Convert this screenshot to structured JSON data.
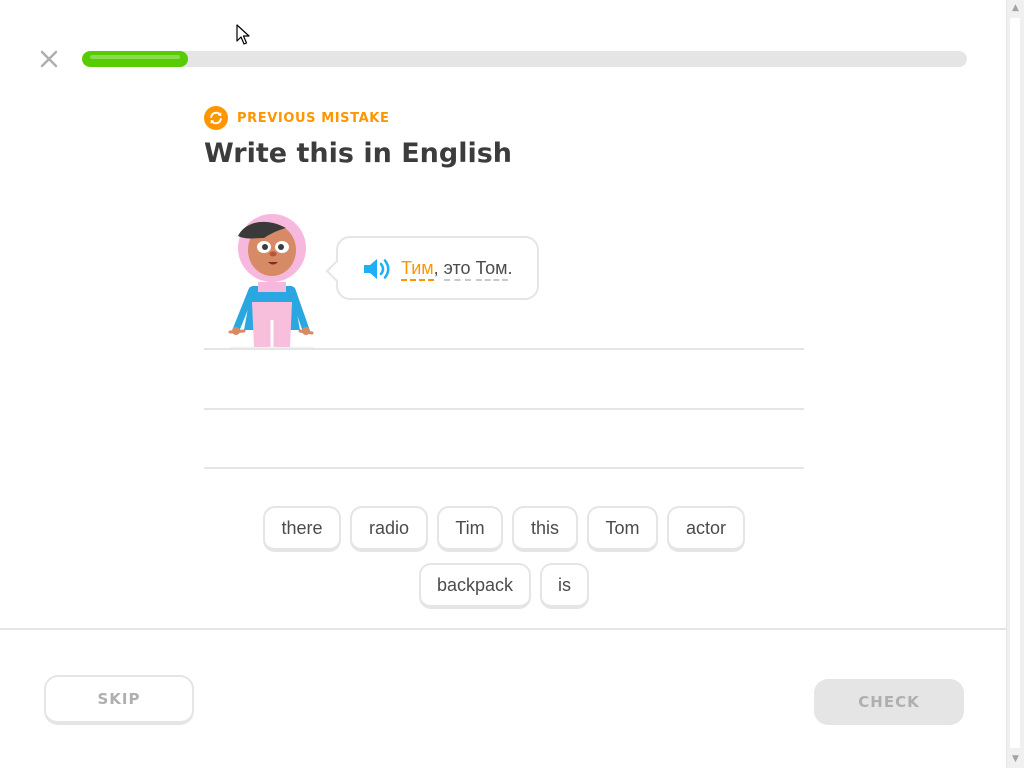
{
  "header": {
    "close_icon": "close-icon",
    "progress": 0.12,
    "progress_color": "#58cc02"
  },
  "challenge": {
    "tag_icon": "refresh-icon",
    "tag": "PREVIOUS MISTAKE",
    "tag_color": "#ff9600",
    "title": "Write this in English"
  },
  "prompt": {
    "speaker_icon": "speaker-icon",
    "highlighted_word": "Тим",
    "comma": ",",
    "word2": "это",
    "word3": "Том",
    "period": "."
  },
  "word_bank": {
    "row1": [
      "there",
      "radio",
      "Tim",
      "this",
      "Tom",
      "actor"
    ],
    "row2": [
      "backpack",
      "is"
    ]
  },
  "footer": {
    "skip_label": "SKIP",
    "check_label": "CHECK"
  }
}
